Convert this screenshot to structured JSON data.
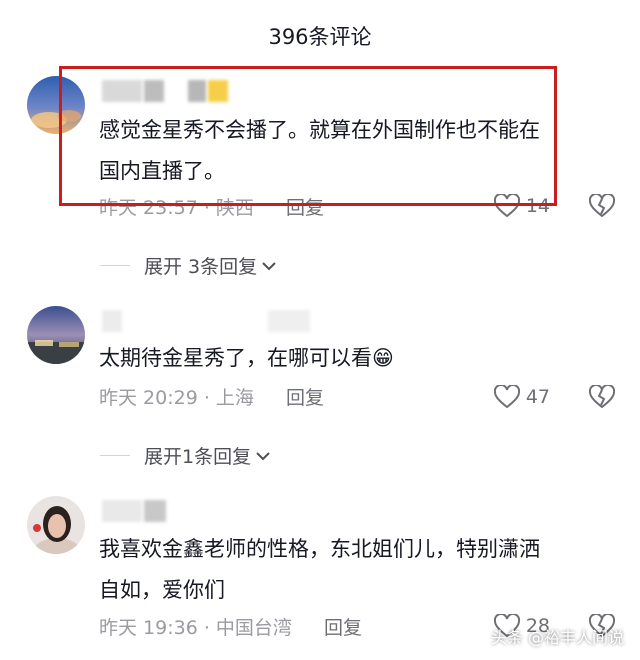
{
  "header": {
    "title": "396条评论"
  },
  "comments": [
    {
      "text_lines": [
        "感觉金星秀不会播了。就算在外国制作也不能在",
        "国内直播了。"
      ],
      "time": "昨天 23:57",
      "location": "陕西",
      "reply_label": "回复",
      "likes": "14",
      "expand_label": "展开 3条回复"
    },
    {
      "text_lines": [
        "太期待金星秀了，在哪可以看"
      ],
      "emoji": "😁",
      "time": "昨天 20:29",
      "location": "上海",
      "reply_label": "回复",
      "likes": "47",
      "expand_label": "展开1条回复"
    },
    {
      "text_lines": [
        "我喜欢金鑫老师的性格，东北姐们儿，特别潇洒",
        "自如，爱你们"
      ],
      "time": "昨天 19:36",
      "location": "中国台湾",
      "reply_label": "回复",
      "likes": "28"
    }
  ],
  "watermark": "头条 @裕丰人间说",
  "colors": {
    "highlight": "#c81e1e",
    "meta": "#9a9ba0",
    "text": "#161823"
  }
}
